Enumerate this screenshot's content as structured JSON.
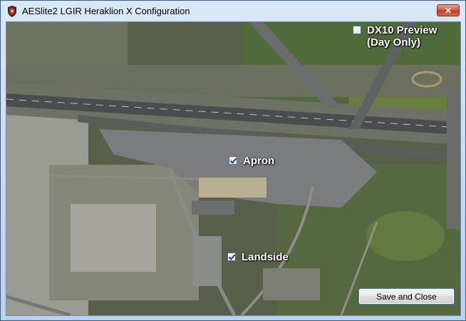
{
  "window": {
    "title": "AESlite2 LGIR Heraklion X Configuration",
    "close_label": "✕"
  },
  "options": [
    {
      "id": "dx10",
      "label": "DX10 Preview\n(Day Only)",
      "checked": false
    },
    {
      "id": "apron",
      "label": "Apron",
      "checked": true
    },
    {
      "id": "landside",
      "label": "Landside",
      "checked": true
    }
  ],
  "buttons": {
    "save_label": "Save and Close"
  }
}
